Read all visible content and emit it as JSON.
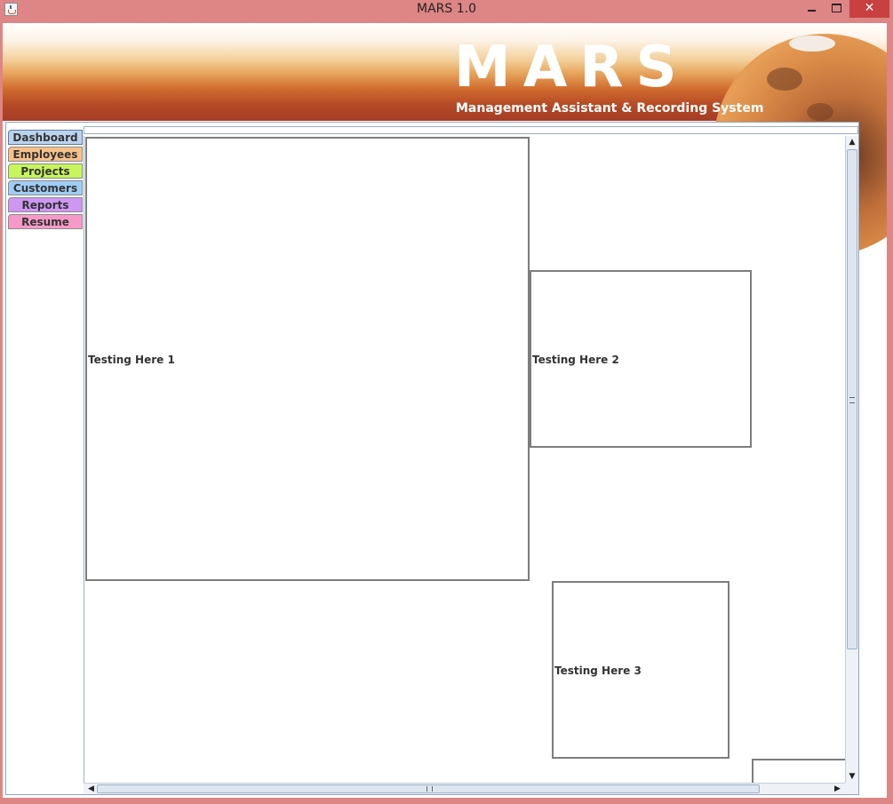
{
  "window": {
    "title": "MARS 1.0",
    "controls": {
      "minimize_icon": "minimize-icon",
      "maximize_icon": "maximize-icon",
      "close_icon": "close-icon",
      "close_label": "✕"
    }
  },
  "banner": {
    "logo_text": "MARS",
    "tagline": "Management Assistant & Recording System"
  },
  "tabs": [
    {
      "label": "Dashboard",
      "color": "#bcd3ee",
      "selected": true
    },
    {
      "label": "Employees",
      "color": "#f7c18a"
    },
    {
      "label": "Projects",
      "color": "#c6f55c"
    },
    {
      "label": "Customers",
      "color": "#9fcdf4"
    },
    {
      "label": "Reports",
      "color": "#cf96f2"
    },
    {
      "label": "Resume",
      "color": "#f59ac8"
    }
  ],
  "dashboard": {
    "frames": [
      {
        "label": "Testing Here 1"
      },
      {
        "label": "Testing Here 2"
      },
      {
        "label": "Testing Here 3"
      },
      {
        "label": ""
      }
    ]
  },
  "scrollbars": {
    "up_arrow": "▲",
    "down_arrow": "▼",
    "left_arrow": "◀",
    "right_arrow": "▶"
  }
}
